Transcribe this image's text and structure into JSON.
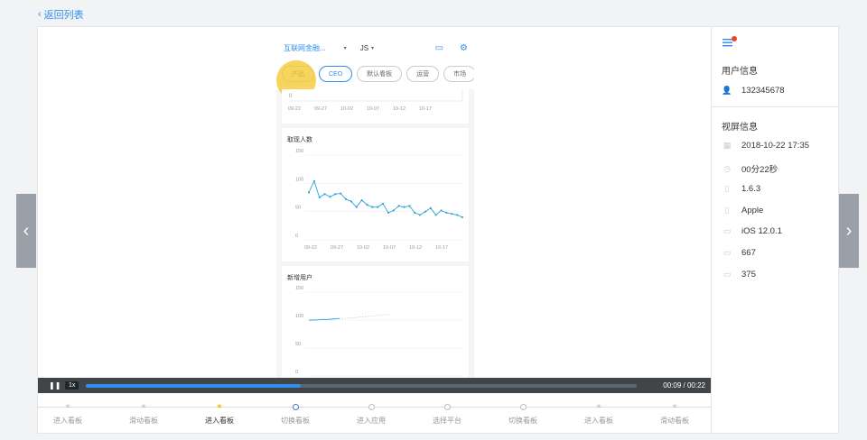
{
  "back_link": "返回列表",
  "phone": {
    "org_name": "互联网金融...",
    "user_short": "JS",
    "chips": [
      "产品",
      "CEO",
      "默认看板",
      "运营",
      "市场"
    ],
    "active_chip_index": 1,
    "top_card": {
      "y_tick": "0",
      "x_ticks": [
        "09-22",
        "09-27",
        "10-02",
        "10-07",
        "10-12",
        "10-17"
      ]
    }
  },
  "chart_data": [
    {
      "type": "line",
      "title": "取现人数",
      "ylim": [
        0,
        150
      ],
      "yticks": [
        "150",
        "100",
        "50",
        "0"
      ],
      "x_ticks": [
        "09-22",
        "09-27",
        "10-02",
        "10-07",
        "10-12",
        "10-17"
      ],
      "series": [
        {
          "values": [
            84,
            104,
            75,
            81,
            76,
            81,
            82,
            72,
            68,
            58,
            70,
            62,
            58,
            58,
            64,
            48,
            52,
            60,
            58,
            60,
            48,
            44,
            50,
            56,
            44,
            52,
            48,
            46,
            44,
            40
          ],
          "color": "#2ea6d9"
        }
      ],
      "grid": true
    },
    {
      "type": "line",
      "title": "新增用户",
      "ylim": [
        0,
        150
      ],
      "yticks": [
        "150",
        "100",
        "50",
        "0"
      ],
      "series": [
        {
          "values": [
            100,
            100,
            101,
            101,
            102,
            103
          ],
          "dashed_continuation": [
            103,
            104,
            105,
            106,
            107,
            108,
            109,
            110
          ],
          "color": "#2ea6d9"
        }
      ],
      "grid": true
    }
  ],
  "player": {
    "speed": "1x",
    "time": "00:09 / 00:22",
    "progress": 0.39
  },
  "timeline": {
    "steps": [
      {
        "label": "进入看板",
        "mark": "star",
        "state": "past"
      },
      {
        "label": "滑动看板",
        "mark": "star",
        "state": "past"
      },
      {
        "label": "进入看板",
        "mark": "star",
        "state": "current"
      },
      {
        "label": "切换看板",
        "mark": "circle",
        "state": "next"
      },
      {
        "label": "进入应用",
        "mark": "circle",
        "state": "future"
      },
      {
        "label": "选择平台",
        "mark": "circle",
        "state": "future"
      },
      {
        "label": "切换看板",
        "mark": "circle",
        "state": "future"
      },
      {
        "label": "进入看板",
        "mark": "star",
        "state": "future"
      },
      {
        "label": "滑动看板",
        "mark": "star",
        "state": "future"
      }
    ]
  },
  "user_info": {
    "title": "用户信息",
    "user_id": "132345678"
  },
  "screen_info": {
    "title": "视屏信息",
    "datetime": "2018-10-22 17:35",
    "duration": "00分22秒",
    "app_version": "1.6.3",
    "brand": "Apple",
    "os": "iOS 12.0.1",
    "screen_height": "667",
    "screen_width": "375"
  },
  "colors": {
    "accent": "#2f8ef0",
    "line": "#2ea6d9",
    "touch": "#f4c830",
    "player_bg": "#3f4549"
  }
}
